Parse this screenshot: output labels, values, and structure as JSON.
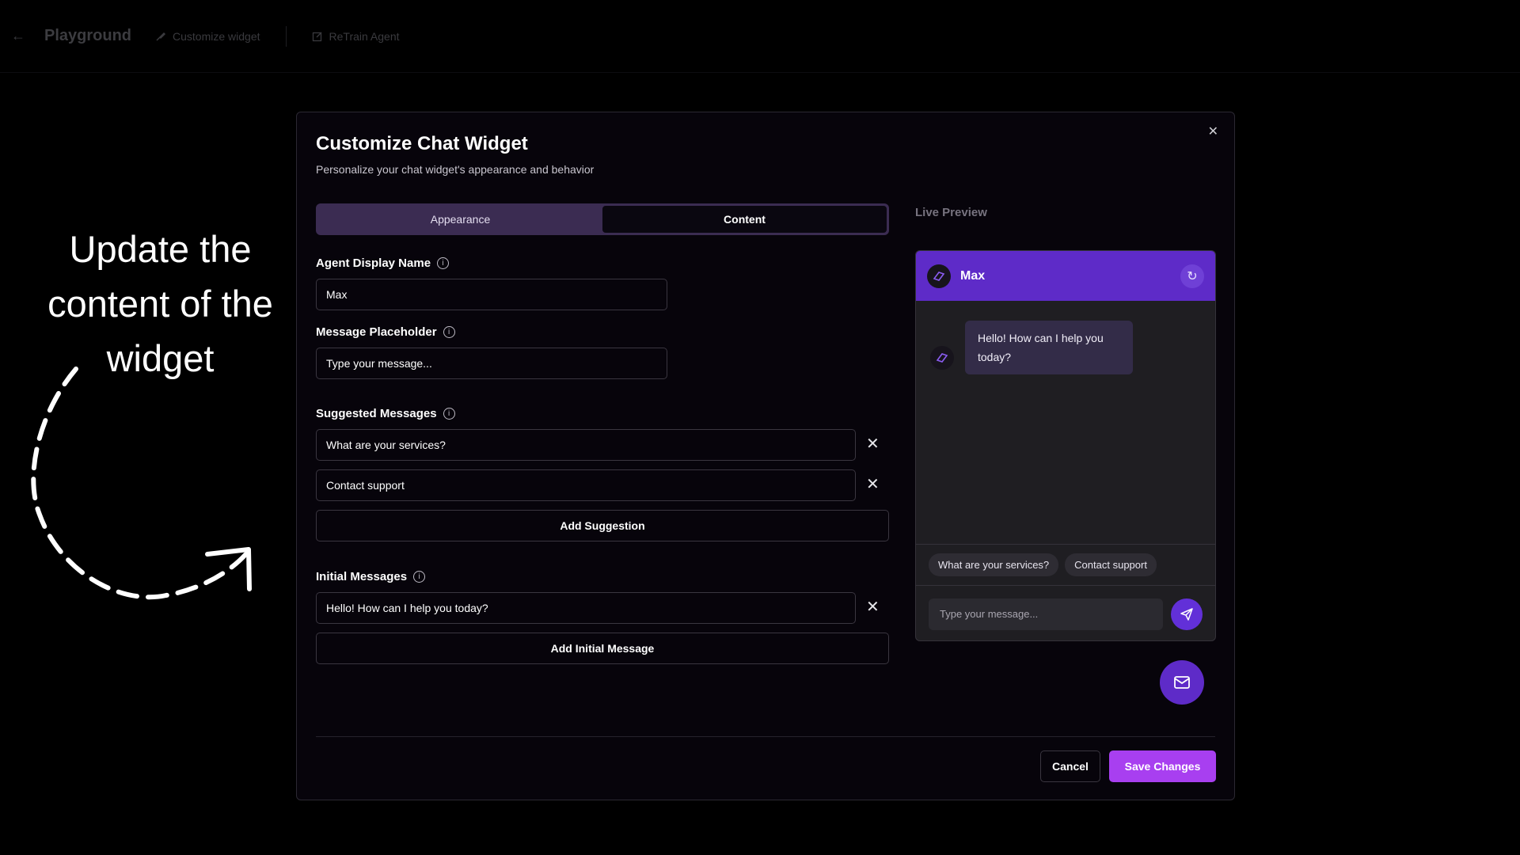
{
  "topbar": {
    "title": "Playground",
    "nav": [
      "Customize widget",
      "ReTrain Agent"
    ]
  },
  "annotation": {
    "text": "Update the content of the widget"
  },
  "modal": {
    "title": "Customize Chat Widget",
    "subtitle": "Personalize your chat widget's appearance and behavior",
    "tabs": [
      {
        "label": "Appearance",
        "active": false
      },
      {
        "label": "Content",
        "active": true
      }
    ],
    "agent_name": {
      "label": "Agent Display Name",
      "value": "Max"
    },
    "placeholder_field": {
      "label": "Message Placeholder",
      "value": "Type your message..."
    },
    "suggested": {
      "label": "Suggested Messages",
      "items": [
        "What are your services?",
        "Contact support"
      ],
      "add_label": "Add Suggestion"
    },
    "initial": {
      "label": "Initial Messages",
      "items": [
        "Hello! How can I help you today?"
      ],
      "add_label": "Add Initial Message"
    },
    "cancel_label": "Cancel",
    "save_label": "Save Changes"
  },
  "preview": {
    "label": "Live Preview",
    "agent_name": "Max",
    "message": "Hello! How can I help you today?",
    "chips": [
      "What are your services?",
      "Contact support"
    ],
    "input_placeholder": "Type your message..."
  },
  "colors": {
    "accent": "#a83ff0",
    "header_purple": "#5e2bc8",
    "background": "#000000"
  }
}
